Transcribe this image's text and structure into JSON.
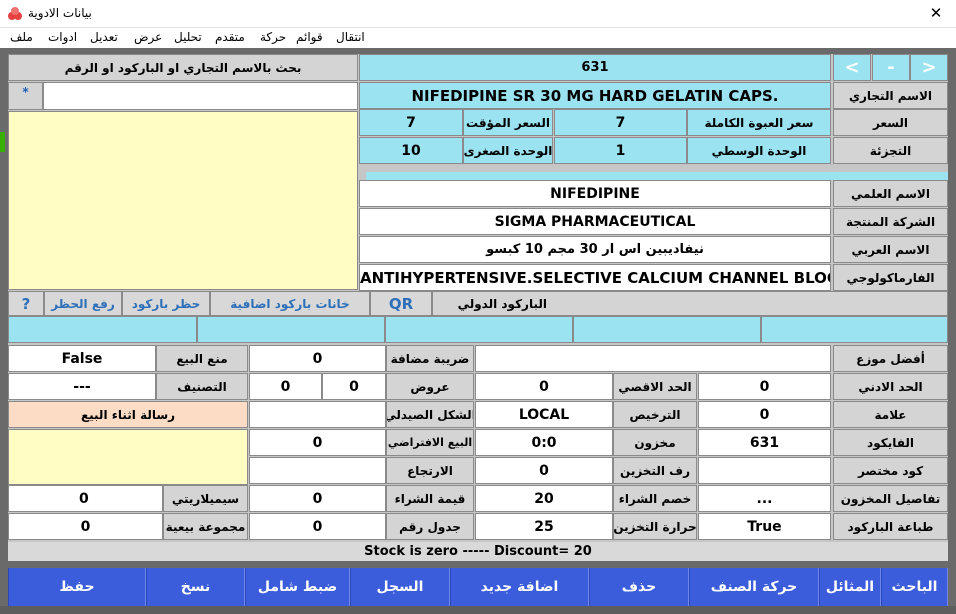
{
  "window": {
    "title": "بيانات الادوية",
    "close": "✕"
  },
  "menu": [
    "ملف",
    "ادوات",
    "تعديل",
    "عرض",
    "تحليل",
    "متقدم",
    "حركة",
    "قوائم",
    "انتقال"
  ],
  "nav": {
    "prev": "<",
    "minus": "-",
    "next": ">"
  },
  "search": {
    "title": "بحث بالاسم التجاري او الباركود او الرقم",
    "star": "*",
    "value": ""
  },
  "record": {
    "number": "631",
    "trade_name_label": "الاسم التجاري",
    "trade_name": "NIFEDIPINE SR 30 MG HARD GELATIN CAPS.",
    "price_label": "السعر",
    "full_pack_price_label": "سعر العبوة الكاملة",
    "full_pack_price": "7",
    "temp_price_label": "السعر المؤقت",
    "temp_price": "7",
    "division_label": "التجزئة",
    "mid_unit_label": "الوحدة الوسطي",
    "mid_unit": "1",
    "small_unit_label": "الوحدة الصغرى",
    "small_unit": "10",
    "scientific_label": "الاسم العلمي",
    "scientific": "NIFEDIPINE",
    "company_label": "الشركة المنتجة",
    "company": "SIGMA PHARMACEUTICAL",
    "arabic_label": "الاسم العربي",
    "arabic": "نيفاديبين اس ار 30 مجم 10 كبسو",
    "pharma_label": "الفارماكولوجي",
    "pharma": "ANTIHYPERTENSIVE.SELECTIVE CALCIUM CHANNEL BLOC"
  },
  "barcode": {
    "intl_label": "الباركود الدولي",
    "qr": "QR",
    "extra": "خانات باركود اضافية",
    "ban": "حظر باركود",
    "unban": "رفع الحظر",
    "help": "?",
    "boxes": [
      "",
      "",
      "",
      "",
      ""
    ]
  },
  "details": {
    "best_dist_label": "أفضل موزع",
    "best_dist": "",
    "vat_label": "ضريبة مضافة",
    "vat": "0",
    "no_sale_label": "منع البيع",
    "no_sale": "False",
    "min_label": "الحد الادني",
    "min": "0",
    "max_label": "الحد الاقصي",
    "max": "0",
    "offers_label": "عروض",
    "offers_a": "0",
    "offers_b": "0",
    "category_label": "التصنيف",
    "category": "---",
    "brand_label": "علامة",
    "brand": "0",
    "license_label": "الترخيص",
    "license": "LOCAL",
    "form_label": "الشكل الصيدلي",
    "form": "",
    "sale_msg_label": "رسالة اثناء البيع",
    "sale_msg": "",
    "pharmacode_label": "الفايكود",
    "pharmacode": "631",
    "stock_label": "مخزون",
    "stock": "0:0",
    "default_sale_label": "البيع الافتراضي",
    "default_sale": "0",
    "shortcode_label": "كود مختصر",
    "shortcode": "",
    "shelf_label": "رف التخزين",
    "shelf": "0",
    "return_label": "الارتجاع",
    "return": "",
    "stock_details_label": "تفاصيل المخزون",
    "stock_details": "...",
    "buy_disc_label": "خصم الشراء",
    "buy_disc": "20",
    "buy_value_label": "قيمة الشراء",
    "buy_value": "0",
    "similarity_label": "سيميلاريتي",
    "similarity": "0",
    "print_bc_label": "طباعة الباركود",
    "print_bc": "True",
    "storage_temp_label": "حرارة التخزين",
    "storage_temp": "25",
    "table_no_label": "جدول رقم",
    "table_no": "0",
    "sale_group_label": "مجموعة بيعية",
    "sale_group": "0"
  },
  "status": "Stock is zero   -----  Discount=  20",
  "buttons": {
    "researcher": "الباحث",
    "similar": "المثائل",
    "item_move": "حركة الصنف",
    "delete": "حذف",
    "add_new": "اضافة جديد",
    "log": "السجل",
    "adjust_all": "ضبط شامل",
    "copy": "نسخ",
    "save": "حفظ"
  },
  "colors": {
    "accent": "#3b5ddc",
    "cyan": "#9be3f0",
    "yellow": "#fffdc3",
    "peach": "#fcdcc4"
  }
}
